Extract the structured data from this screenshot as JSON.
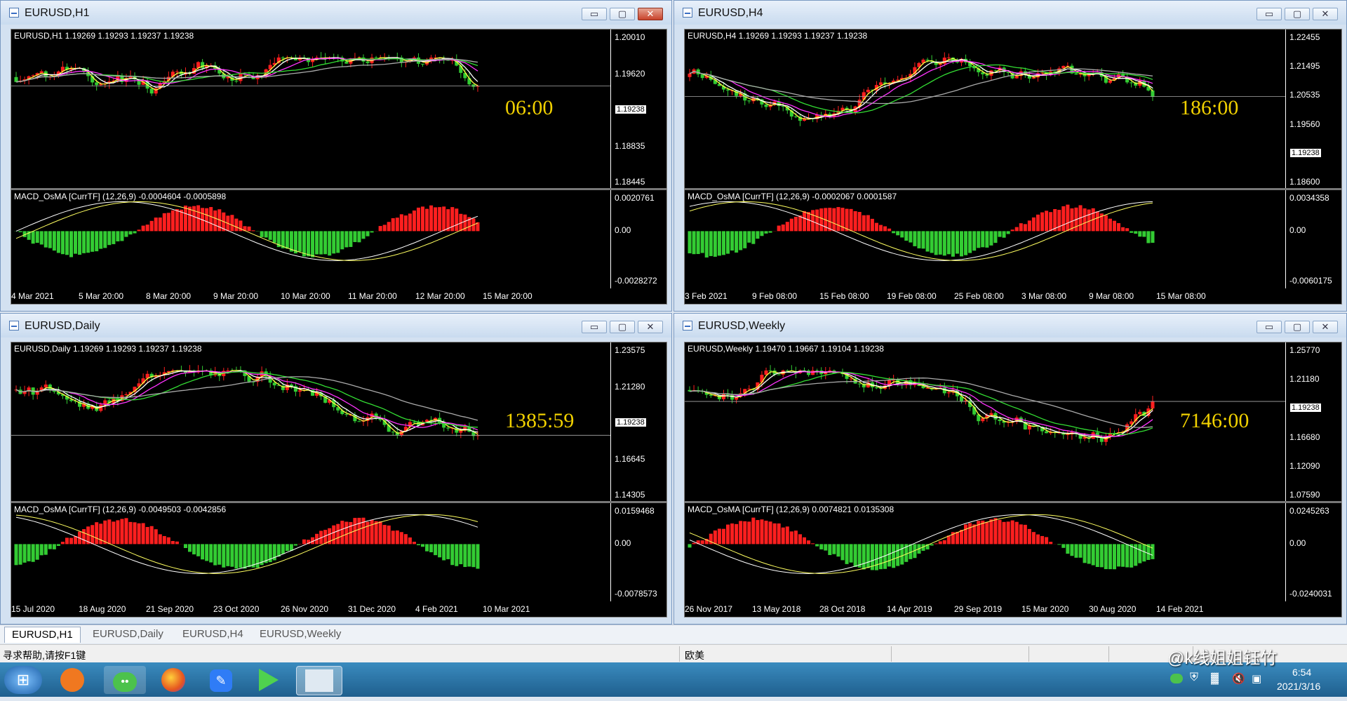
{
  "windows": [
    {
      "title": "EURUSD,H1",
      "main_header": "EURUSD,H1  1.19269 1.19293 1.19237 1.19238",
      "price_scale": [
        "1.20010",
        "1.19620",
        "1.19238",
        "1.18835",
        "1.18445"
      ],
      "current_price": "1.19238",
      "timer": "06:00",
      "indicator_header": "MACD_OsMA [CurrTF] (12,26,9) -0.0004604 -0.0005898",
      "indicator_scale": [
        "0.0020761",
        "0.00",
        "-0.0028272"
      ],
      "time_axis": [
        "4 Mar 2021",
        "5 Mar 20:00",
        "8 Mar 20:00",
        "9 Mar 20:00",
        "10 Mar 20:00",
        "11 Mar 20:00",
        "12 Mar 20:00",
        "15 Mar 20:00"
      ],
      "active": true
    },
    {
      "title": "EURUSD,H4",
      "main_header": "EURUSD,H4  1.19269 1.19293 1.19237 1.19238",
      "price_scale": [
        "1.22455",
        "1.21495",
        "1.20535",
        "1.19560",
        "1.19238",
        "1.18600"
      ],
      "current_price": "1.19238",
      "timer": "186:00",
      "indicator_header": "MACD_OsMA [CurrTF] (12,26,9) -0.0002067 0.0001587",
      "indicator_scale": [
        "0.0034358",
        "0.00",
        "-0.0060175"
      ],
      "time_axis": [
        "3 Feb 2021",
        "9 Feb 08:00",
        "15 Feb 08:00",
        "19 Feb 08:00",
        "25 Feb 08:00",
        "3 Mar 08:00",
        "9 Mar 08:00",
        "15 Mar 08:00"
      ],
      "active": false
    },
    {
      "title": "EURUSD,Daily",
      "main_header": "EURUSD,Daily  1.19269 1.19293 1.19237 1.19238",
      "price_scale": [
        "1.23575",
        "1.21280",
        "1.19238",
        "1.16645",
        "1.14305"
      ],
      "current_price": "1.19238",
      "timer": "1385:59",
      "indicator_header": "MACD_OsMA [CurrTF] (12,26,9) -0.0049503 -0.0042856",
      "indicator_scale": [
        "0.0159468",
        "0.00",
        "-0.0078573"
      ],
      "time_axis": [
        "15 Jul 2020",
        "18 Aug 2020",
        "21 Sep 2020",
        "23 Oct 2020",
        "26 Nov 2020",
        "31 Dec 2020",
        "4 Feb 2021",
        "10 Mar 2021"
      ],
      "active": false
    },
    {
      "title": "EURUSD,Weekly",
      "main_header": "EURUSD,Weekly  1.19470 1.19667 1.19104 1.19238",
      "price_scale": [
        "1.25770",
        "1.21180",
        "1.19238",
        "1.16680",
        "1.12090",
        "1.07590"
      ],
      "current_price": "1.19238",
      "timer": "7146:00",
      "indicator_header": "MACD_OsMA [CurrTF] (12,26,9) 0.0074821 0.0135308",
      "indicator_scale": [
        "0.0245263",
        "0.00",
        "-0.0240031"
      ],
      "time_axis": [
        "26 Nov 2017",
        "13 May 2018",
        "28 Oct 2018",
        "14 Apr 2019",
        "29 Sep 2019",
        "15 Mar 2020",
        "30 Aug 2020",
        "14 Feb 2021"
      ],
      "active": false
    }
  ],
  "window_buttons": {
    "minimize": "▭",
    "maximize": "▢",
    "close": "✕"
  },
  "tabs": [
    "EURUSD,H1",
    "EURUSD,Daily",
    "EURUSD,H4",
    "EURUSD,Weekly"
  ],
  "active_tab": "EURUSD,H1",
  "status": {
    "help": "寻求帮助,请按F1键",
    "profile": "欧美"
  },
  "watermark": "@k线姐姐钰竹",
  "clock": {
    "time": "6:54",
    "date": "2021/3/16"
  },
  "taskbar_icons": [
    "start-orb-icon",
    "app-orange-icon",
    "wechat-icon",
    "firefox-icon",
    "pen-app-icon",
    "video-player-icon",
    "trading-app-icon"
  ],
  "colors": {
    "bull": "#ff1f1f",
    "bear": "#33cc33",
    "ma_fast": "#ffff40",
    "ma_mid": "#ffffff",
    "ma_slow": "#ff33ff",
    "ma_green": "#33dd33",
    "ma_grey": "#aaaaaa",
    "timer": "#f0d000"
  }
}
